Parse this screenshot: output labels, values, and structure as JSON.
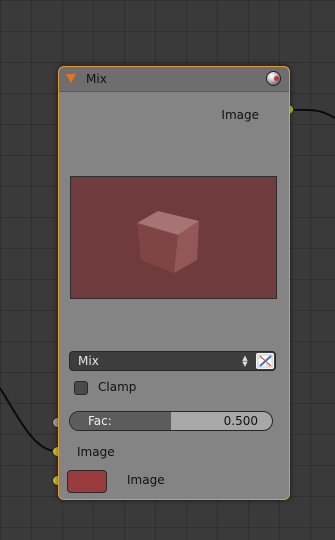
{
  "node": {
    "title": "Mix",
    "output_label": "Image",
    "blend_type": "Mix",
    "clamp_label": "Clamp",
    "clamp_checked": false,
    "fac_label": "Fac:",
    "fac_value": "0.500",
    "fac_fraction": 0.5,
    "input_image_label": "Image",
    "color_input_label": "Image",
    "color_swatch": "#9b3c3c",
    "preview_background": "#6f3b3d",
    "cube_color": "#a86a6a",
    "accent_border": "#e39b3a",
    "socket_color": "#c7c729"
  },
  "icons": {
    "collapse": "collapse-triangle-icon",
    "preview": "preview-sphere-icon",
    "updown": "up-down-arrows-icon",
    "clamp": "color-picker-icon"
  }
}
